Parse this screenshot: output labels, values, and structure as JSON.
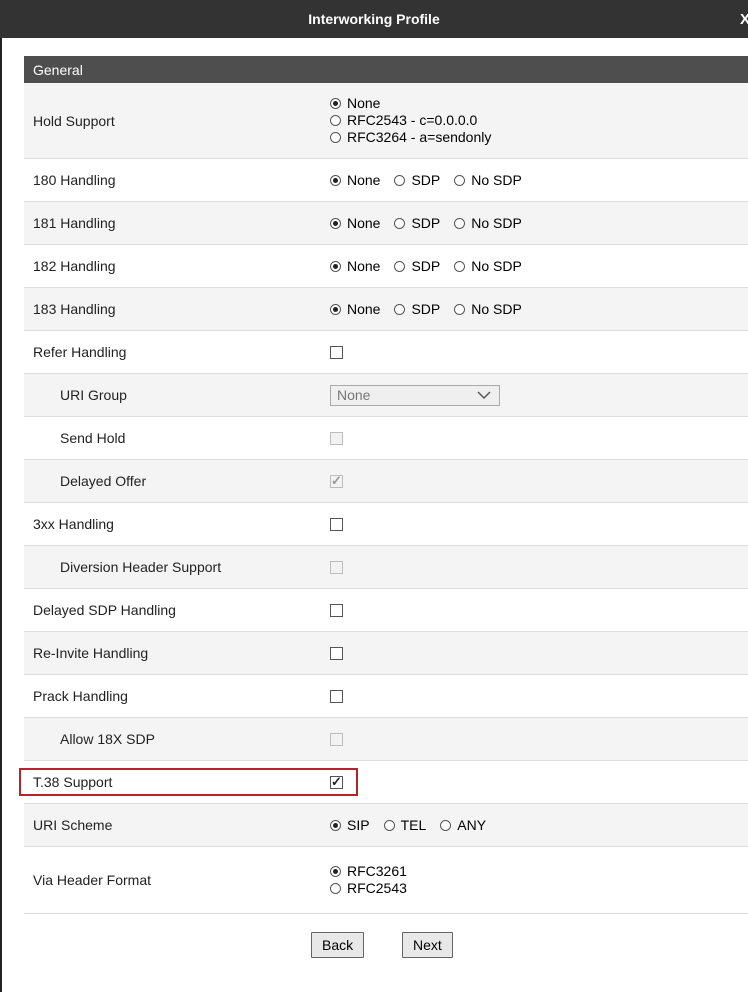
{
  "dialog": {
    "title": "Interworking Profile",
    "close_label": "X"
  },
  "section": {
    "title": "General"
  },
  "rows": {
    "hold_support": {
      "label": "Hold Support",
      "options": [
        "None",
        "RFC2543 - c=0.0.0.0",
        "RFC3264 - a=sendonly"
      ],
      "selected": "None"
    },
    "h180": {
      "label": "180 Handling",
      "options": [
        "None",
        "SDP",
        "No SDP"
      ],
      "selected": "None"
    },
    "h181": {
      "label": "181 Handling",
      "options": [
        "None",
        "SDP",
        "No SDP"
      ],
      "selected": "None"
    },
    "h182": {
      "label": "182 Handling",
      "options": [
        "None",
        "SDP",
        "No SDP"
      ],
      "selected": "None"
    },
    "h183": {
      "label": "183 Handling",
      "options": [
        "None",
        "SDP",
        "No SDP"
      ],
      "selected": "None"
    },
    "refer": {
      "label": "Refer Handling",
      "checked": false
    },
    "uri_group": {
      "label": "URI Group",
      "value": "None"
    },
    "send_hold": {
      "label": "Send Hold",
      "checked": false,
      "disabled": true
    },
    "delayed_offer": {
      "label": "Delayed Offer",
      "checked": true,
      "disabled": true
    },
    "h3xx": {
      "label": "3xx Handling",
      "checked": false
    },
    "diversion": {
      "label": "Diversion Header Support",
      "checked": false,
      "disabled": true
    },
    "delayed_sdp": {
      "label": "Delayed SDP Handling",
      "checked": false
    },
    "reinvite": {
      "label": "Re-Invite Handling",
      "checked": false
    },
    "prack": {
      "label": "Prack Handling",
      "checked": false
    },
    "allow18x": {
      "label": "Allow 18X SDP",
      "checked": false,
      "disabled": true
    },
    "t38": {
      "label": "T.38 Support",
      "checked": true
    },
    "uri_scheme": {
      "label": "URI Scheme",
      "options": [
        "SIP",
        "TEL",
        "ANY"
      ],
      "selected": "SIP"
    },
    "via_header": {
      "label": "Via Header Format",
      "options": [
        "RFC3261",
        "RFC2543"
      ],
      "selected": "RFC3261"
    }
  },
  "buttons": {
    "back": "Back",
    "next": "Next"
  },
  "colors": {
    "titlebar": "#333333",
    "section_header": "#4e4e4e",
    "highlight": "#b5242a"
  }
}
